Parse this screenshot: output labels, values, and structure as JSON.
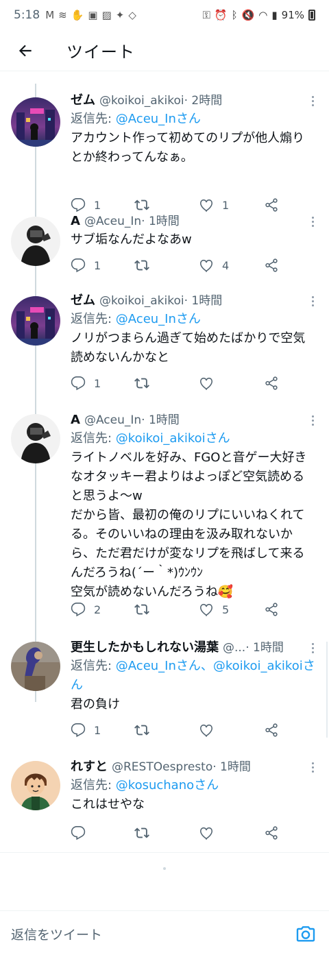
{
  "status": {
    "time": "5:18",
    "battery": "91%"
  },
  "header": {
    "title": "ツイート"
  },
  "tweets": [
    {
      "name": "ゼム",
      "handle": "@koikoi_akikoi",
      "time": "· 2時間",
      "reply_prefix": "返信先: ",
      "reply_mentions": "@Aceu_Inさん",
      "text": "アカウント作って初めてのリプが他人煽りとか終わってんなぁ。",
      "replies": "1",
      "retweets": "",
      "likes": "1",
      "avatar": "city-night"
    },
    {
      "name": "A",
      "handle": "@Aceu_In",
      "time": "· 1時間",
      "reply_prefix": "",
      "reply_mentions": "",
      "text": "サブ垢なんだよなあw",
      "replies": "1",
      "retweets": "",
      "likes": "4",
      "avatar": "mono-person"
    },
    {
      "name": "ゼム",
      "handle": "@koikoi_akikoi",
      "time": "· 1時間",
      "reply_prefix": "返信先: ",
      "reply_mentions": "@Aceu_Inさん",
      "text": "ノリがつまらん過ぎて始めたばかりで空気読めないんかなと",
      "replies": "1",
      "retweets": "",
      "likes": "",
      "avatar": "city-night"
    },
    {
      "name": "A",
      "handle": "@Aceu_In",
      "time": "· 1時間",
      "reply_prefix": "返信先: ",
      "reply_mentions": "@koikoi_akikoiさん",
      "text": "ライトノベルを好み、FGOと音ゲー大好きなオタッキー君よりはよっぽど空気読めると思うよ〜w\nだから皆、最初の俺のリプにいいねくれてる。そのいいねの理由を汲み取れないから、ただ君だけが変なリプを飛ばして来るんだろうね(´ー｀*)ｳﾝｳﾝ\n空気が読めないんだろうね🥰",
      "replies": "2",
      "retweets": "",
      "likes": "5",
      "avatar": "mono-person"
    },
    {
      "name": "更生したかもしれない湯葉",
      "handle": "@...",
      "time": "· 1時間",
      "reply_prefix": "返信先: ",
      "reply_mentions": "@Aceu_Inさん、@koikoi_akikoiさん",
      "text": "君の負け",
      "replies": "1",
      "retweets": "",
      "likes": "",
      "avatar": "blur-figure"
    },
    {
      "name": "れすと",
      "handle": "@RESTOespresto",
      "time": "· 1時間",
      "reply_prefix": "返信先: ",
      "reply_mentions": "@kosuchanoさん",
      "text": "これはせやな",
      "replies": "",
      "retweets": "",
      "likes": "",
      "avatar": "cartoon-boy"
    }
  ],
  "composer": {
    "placeholder": "返信をツイート"
  },
  "colors": {
    "link": "#1d9bf0",
    "secondary": "#536471",
    "thread_line": "#cfd9de"
  }
}
